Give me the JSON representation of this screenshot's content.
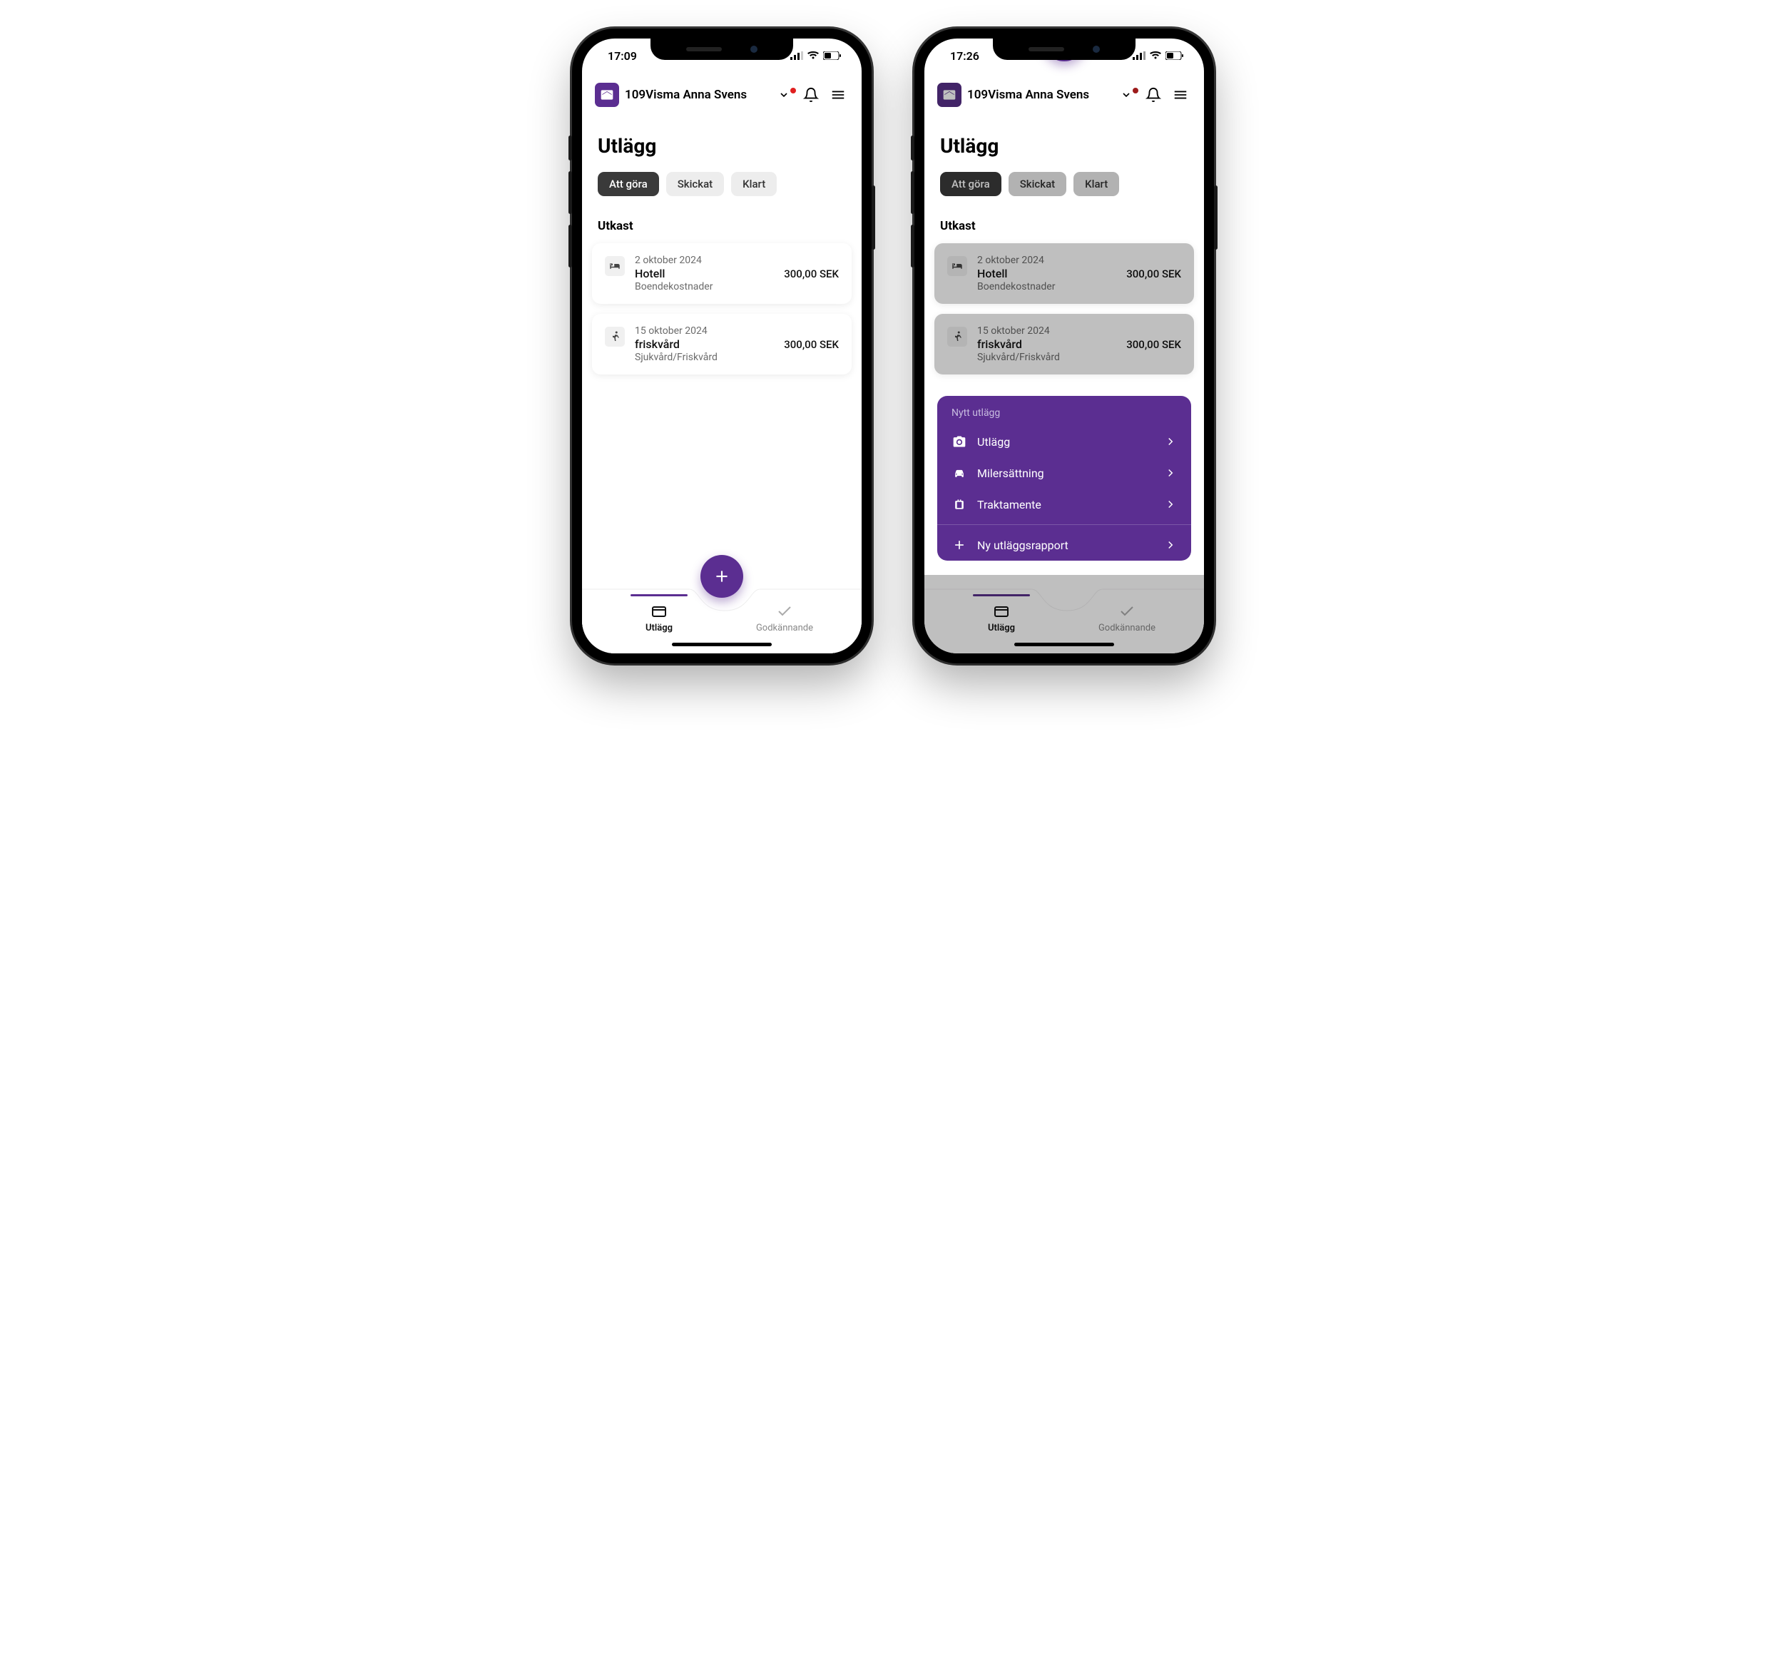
{
  "phone_left": {
    "status": {
      "time": "17:09"
    },
    "header": {
      "title": "109Visma Anna Svens"
    },
    "page_title": "Utlägg",
    "tabs": [
      {
        "label": "Att göra",
        "active": true
      },
      {
        "label": "Skickat",
        "active": false
      },
      {
        "label": "Klart",
        "active": false
      }
    ],
    "section_label": "Utkast",
    "cards": [
      {
        "date": "2 oktober 2024",
        "title": "Hotell",
        "subtitle": "Boendekostnader",
        "amount": "300,00 SEK",
        "icon": "bed"
      },
      {
        "date": "15 oktober 2024",
        "title": "friskvård",
        "subtitle": "Sjukvård/Friskvård",
        "amount": "300,00 SEK",
        "icon": "running"
      }
    ],
    "bottom_nav": {
      "item1": "Utlägg",
      "item2": "Godkännande"
    }
  },
  "phone_right": {
    "status": {
      "time": "17:26"
    },
    "header": {
      "title": "109Visma Anna Svens"
    },
    "page_title": "Utlägg",
    "tabs": [
      {
        "label": "Att göra",
        "active": true
      },
      {
        "label": "Skickat",
        "active": false
      },
      {
        "label": "Klart",
        "active": false
      }
    ],
    "section_label": "Utkast",
    "cards": [
      {
        "date": "2 oktober 2024",
        "title": "Hotell",
        "subtitle": "Boendekostnader",
        "amount": "300,00 SEK",
        "icon": "bed"
      },
      {
        "date": "15 oktober 2024",
        "title": "friskvård",
        "subtitle": "Sjukvård/Friskvård",
        "amount": "300,00 SEK",
        "icon": "running"
      }
    ],
    "bottom_nav": {
      "item1": "Utlägg",
      "item2": "Godkännande"
    },
    "popup": {
      "title": "Nytt utlägg",
      "items": [
        {
          "label": "Utlägg",
          "icon": "camera"
        },
        {
          "label": "Milersättning",
          "icon": "car"
        },
        {
          "label": "Traktamente",
          "icon": "luggage"
        }
      ],
      "report": {
        "label": "Ny utläggsrapport",
        "icon": "plus"
      }
    }
  }
}
